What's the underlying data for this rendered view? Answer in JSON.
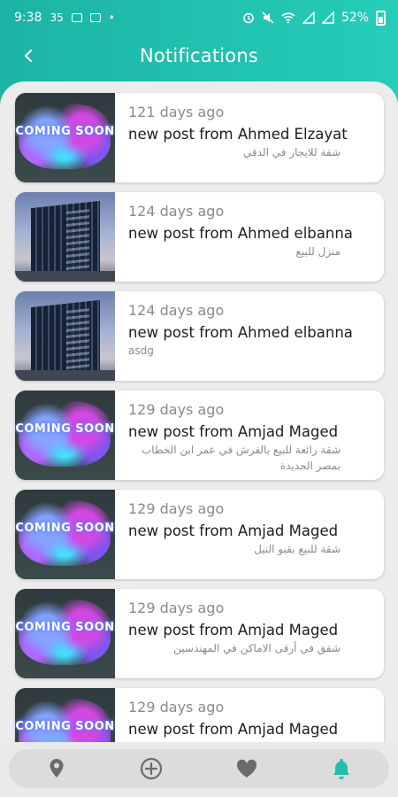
{
  "status_bar": {
    "time": "9:38",
    "battery": "52%"
  },
  "header": {
    "title": "Notifications",
    "back_icon": "chevron-left-icon"
  },
  "colors": {
    "accent": "#21c0ae",
    "active_nav": "#21c0ae",
    "inactive_nav": "#6b6b6b"
  },
  "notifications": [
    {
      "time": "121 days ago",
      "message": "new post from Ahmed Elzayat",
      "description": "شقة للايجار في الدقي",
      "image": "coming-soon"
    },
    {
      "time": "124 days ago",
      "message": "new post from Ahmed elbanna",
      "description": "منزل للبيع",
      "image": "building"
    },
    {
      "time": "124 days ago",
      "message": "new post from Ahmed elbanna",
      "description": "asdg",
      "image": "building"
    },
    {
      "time": "129 days ago",
      "message": "new post from Amjad Maged",
      "description": "شقة رائعة للبيع بالفرش في عمر ابن الخطاب بمصر الجديدة",
      "image": "coming-soon"
    },
    {
      "time": "129 days ago",
      "message": "new post from Amjad Maged",
      "description": "شقة للبيع بقبو النيل",
      "image": "coming-soon"
    },
    {
      "time": "129 days ago",
      "message": "new post from Amjad Maged",
      "description": "شقق في أرقى الاماكن في المهندسين",
      "image": "coming-soon"
    },
    {
      "time": "129 days ago",
      "message": "new post from Amjad Maged",
      "description": "",
      "image": "coming-soon"
    }
  ],
  "coming_soon_text": "COMING SOON",
  "bottom_nav": [
    {
      "icon": "location-pin-icon",
      "active": false
    },
    {
      "icon": "add-circle-icon",
      "active": false
    },
    {
      "icon": "heart-icon",
      "active": false
    },
    {
      "icon": "bell-icon",
      "active": true
    }
  ]
}
